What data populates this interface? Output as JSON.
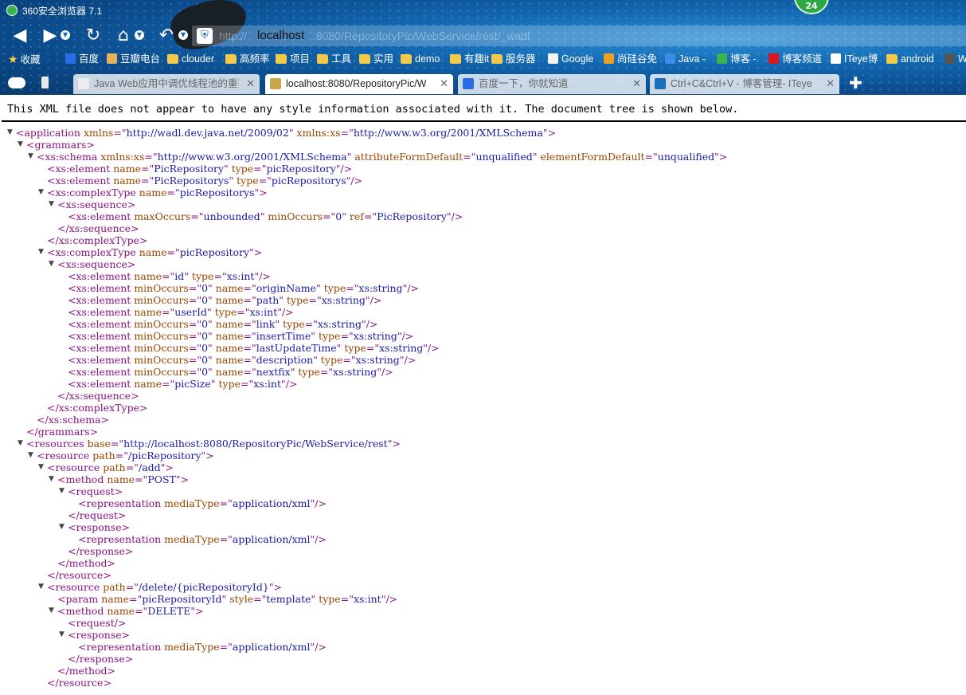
{
  "window": {
    "title": "360安全浏览器 7.1",
    "notification_count": "24"
  },
  "address_bar": {
    "prefix": "http://",
    "host": "localhost",
    "rest": ":8080/RepositoryPic/WebService/rest/_wadl"
  },
  "bookmarks": [
    {
      "label": "收藏",
      "icon": "star-icon"
    },
    {
      "label": "百度",
      "icon": "baidu-paw-icon"
    },
    {
      "label": "豆瓣电台",
      "icon": "douban-icon"
    },
    {
      "label": "clouder",
      "icon": "folder-icon"
    },
    {
      "label": "高频率",
      "icon": "folder-icon"
    },
    {
      "label": "项目",
      "icon": "folder-icon"
    },
    {
      "label": "工具",
      "icon": "folder-icon"
    },
    {
      "label": "实用",
      "icon": "folder-icon"
    },
    {
      "label": "demo",
      "icon": "folder-icon"
    },
    {
      "label": "有趣it",
      "icon": "folder-icon"
    },
    {
      "label": "服务器",
      "icon": "folder-icon"
    },
    {
      "label": "Google",
      "icon": "page-icon"
    },
    {
      "label": "尚硅谷免",
      "icon": "u-logo-icon"
    },
    {
      "label": "Java -",
      "icon": "b-logo-icon"
    },
    {
      "label": "博客 -",
      "icon": "c-logo-icon"
    },
    {
      "label": "博客频道",
      "icon": "csdn-icon"
    },
    {
      "label": "ITeye博",
      "icon": "iteye-icon"
    },
    {
      "label": "android",
      "icon": "folder-icon"
    },
    {
      "label": "W",
      "icon": "cloud-app-icon"
    }
  ],
  "tabs": [
    {
      "title": "Java Web应用中调优线程池的重要",
      "active": false,
      "icon": "page-icon"
    },
    {
      "title": "localhost:8080/RepositoryPic/W",
      "active": true,
      "icon": "xml-icon"
    },
    {
      "title": "百度一下，你就知道",
      "active": false,
      "icon": "baidu-paw-icon"
    },
    {
      "title": "Ctrl+C&Ctrl+V - 博客管理- ITeye",
      "active": false,
      "icon": "iteye-icon"
    }
  ],
  "notice": "This XML file does not appear to have any style information associated with it. The document tree is shown below.",
  "colors": {
    "tag": "#881280",
    "attr_name": "#994500",
    "attr_value": "#1a1aa6"
  },
  "xml_lines": [
    {
      "d": 0,
      "t": "open",
      "tag": "application",
      "attrs": [
        [
          "xmlns",
          "http://wadl.dev.java.net/2009/02"
        ],
        [
          "xmlns:xs",
          "http://www.w3.org/2001/XMLSchema"
        ]
      ]
    },
    {
      "d": 1,
      "t": "open",
      "tag": "grammars",
      "attrs": []
    },
    {
      "d": 2,
      "t": "open",
      "tag": "xs:schema",
      "attrs": [
        [
          "xmlns:xs",
          "http://www.w3.org/2001/XMLSchema"
        ],
        [
          "attributeFormDefault",
          "unqualified"
        ],
        [
          "elementFormDefault",
          "unqualified"
        ]
      ]
    },
    {
      "d": 3,
      "t": "self",
      "tag": "xs:element",
      "attrs": [
        [
          "name",
          "PicRepository"
        ],
        [
          "type",
          "picRepository"
        ]
      ]
    },
    {
      "d": 3,
      "t": "self",
      "tag": "xs:element",
      "attrs": [
        [
          "name",
          "PicRepositorys"
        ],
        [
          "type",
          "picRepositorys"
        ]
      ]
    },
    {
      "d": 3,
      "t": "open",
      "tag": "xs:complexType",
      "attrs": [
        [
          "name",
          "picRepositorys"
        ]
      ]
    },
    {
      "d": 4,
      "t": "open",
      "tag": "xs:sequence",
      "attrs": []
    },
    {
      "d": 5,
      "t": "self",
      "tag": "xs:element",
      "attrs": [
        [
          "maxOccurs",
          "unbounded"
        ],
        [
          "minOccurs",
          "0"
        ],
        [
          "ref",
          "PicRepository"
        ]
      ]
    },
    {
      "d": 4,
      "t": "close",
      "tag": "xs:sequence",
      "attrs": []
    },
    {
      "d": 3,
      "t": "close",
      "tag": "xs:complexType",
      "attrs": []
    },
    {
      "d": 3,
      "t": "open",
      "tag": "xs:complexType",
      "attrs": [
        [
          "name",
          "picRepository"
        ]
      ]
    },
    {
      "d": 4,
      "t": "open",
      "tag": "xs:sequence",
      "attrs": []
    },
    {
      "d": 5,
      "t": "self",
      "tag": "xs:element",
      "attrs": [
        [
          "name",
          "id"
        ],
        [
          "type",
          "xs:int"
        ]
      ]
    },
    {
      "d": 5,
      "t": "self",
      "tag": "xs:element",
      "attrs": [
        [
          "minOccurs",
          "0"
        ],
        [
          "name",
          "originName"
        ],
        [
          "type",
          "xs:string"
        ]
      ]
    },
    {
      "d": 5,
      "t": "self",
      "tag": "xs:element",
      "attrs": [
        [
          "minOccurs",
          "0"
        ],
        [
          "name",
          "path"
        ],
        [
          "type",
          "xs:string"
        ]
      ]
    },
    {
      "d": 5,
      "t": "self",
      "tag": "xs:element",
      "attrs": [
        [
          "name",
          "userId"
        ],
        [
          "type",
          "xs:int"
        ]
      ]
    },
    {
      "d": 5,
      "t": "self",
      "tag": "xs:element",
      "attrs": [
        [
          "minOccurs",
          "0"
        ],
        [
          "name",
          "link"
        ],
        [
          "type",
          "xs:string"
        ]
      ]
    },
    {
      "d": 5,
      "t": "self",
      "tag": "xs:element",
      "attrs": [
        [
          "minOccurs",
          "0"
        ],
        [
          "name",
          "insertTime"
        ],
        [
          "type",
          "xs:string"
        ]
      ]
    },
    {
      "d": 5,
      "t": "self",
      "tag": "xs:element",
      "attrs": [
        [
          "minOccurs",
          "0"
        ],
        [
          "name",
          "lastUpdateTime"
        ],
        [
          "type",
          "xs:string"
        ]
      ]
    },
    {
      "d": 5,
      "t": "self",
      "tag": "xs:element",
      "attrs": [
        [
          "minOccurs",
          "0"
        ],
        [
          "name",
          "description"
        ],
        [
          "type",
          "xs:string"
        ]
      ]
    },
    {
      "d": 5,
      "t": "self",
      "tag": "xs:element",
      "attrs": [
        [
          "minOccurs",
          "0"
        ],
        [
          "name",
          "nextfix"
        ],
        [
          "type",
          "xs:string"
        ]
      ]
    },
    {
      "d": 5,
      "t": "self",
      "tag": "xs:element",
      "attrs": [
        [
          "name",
          "picSize"
        ],
        [
          "type",
          "xs:int"
        ]
      ]
    },
    {
      "d": 4,
      "t": "close",
      "tag": "xs:sequence",
      "attrs": []
    },
    {
      "d": 3,
      "t": "close",
      "tag": "xs:complexType",
      "attrs": []
    },
    {
      "d": 2,
      "t": "close",
      "tag": "xs:schema",
      "attrs": []
    },
    {
      "d": 1,
      "t": "close",
      "tag": "grammars",
      "attrs": []
    },
    {
      "d": 1,
      "t": "open",
      "tag": "resources",
      "attrs": [
        [
          "base",
          "http://localhost:8080/RepositoryPic/WebService/rest"
        ]
      ]
    },
    {
      "d": 2,
      "t": "open",
      "tag": "resource",
      "attrs": [
        [
          "path",
          "/picRepository"
        ]
      ]
    },
    {
      "d": 3,
      "t": "open",
      "tag": "resource",
      "attrs": [
        [
          "path",
          "/add"
        ]
      ]
    },
    {
      "d": 4,
      "t": "open",
      "tag": "method",
      "attrs": [
        [
          "name",
          "POST"
        ]
      ]
    },
    {
      "d": 5,
      "t": "open",
      "tag": "request",
      "attrs": []
    },
    {
      "d": 6,
      "t": "self",
      "tag": "representation",
      "attrs": [
        [
          "mediaType",
          "application/xml"
        ]
      ]
    },
    {
      "d": 5,
      "t": "close",
      "tag": "request",
      "attrs": []
    },
    {
      "d": 5,
      "t": "open",
      "tag": "response",
      "attrs": []
    },
    {
      "d": 6,
      "t": "self",
      "tag": "representation",
      "attrs": [
        [
          "mediaType",
          "application/xml"
        ]
      ]
    },
    {
      "d": 5,
      "t": "close",
      "tag": "response",
      "attrs": []
    },
    {
      "d": 4,
      "t": "close",
      "tag": "method",
      "attrs": []
    },
    {
      "d": 3,
      "t": "close",
      "tag": "resource",
      "attrs": []
    },
    {
      "d": 3,
      "t": "open",
      "tag": "resource",
      "attrs": [
        [
          "path",
          "/delete/{picRepositoryId}"
        ]
      ]
    },
    {
      "d": 4,
      "t": "self",
      "tag": "param",
      "attrs": [
        [
          "name",
          "picRepositoryId"
        ],
        [
          "style",
          "template"
        ],
        [
          "type",
          "xs:int"
        ]
      ]
    },
    {
      "d": 4,
      "t": "open",
      "tag": "method",
      "attrs": [
        [
          "name",
          "DELETE"
        ]
      ]
    },
    {
      "d": 5,
      "t": "self",
      "tag": "request",
      "attrs": []
    },
    {
      "d": 5,
      "t": "open",
      "tag": "response",
      "attrs": []
    },
    {
      "d": 6,
      "t": "self",
      "tag": "representation",
      "attrs": [
        [
          "mediaType",
          "application/xml"
        ]
      ]
    },
    {
      "d": 5,
      "t": "close",
      "tag": "response",
      "attrs": []
    },
    {
      "d": 4,
      "t": "close",
      "tag": "method",
      "attrs": []
    },
    {
      "d": 3,
      "t": "close",
      "tag": "resource",
      "attrs": []
    }
  ]
}
